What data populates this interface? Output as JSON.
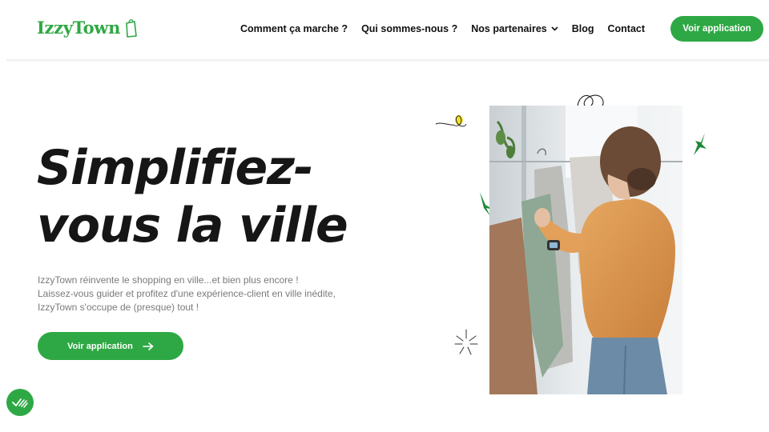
{
  "header": {
    "logo_text": "IzzyTown",
    "nav": [
      {
        "label": "Comment ça marche ?",
        "has_dropdown": false
      },
      {
        "label": "Qui sommes-nous ?",
        "has_dropdown": false
      },
      {
        "label": "Nos partenaires",
        "has_dropdown": true
      },
      {
        "label": "Blog",
        "has_dropdown": false
      },
      {
        "label": "Contact",
        "has_dropdown": false
      }
    ],
    "cta_label": "Voir application"
  },
  "hero": {
    "title_line1": "Simplifiez-",
    "title_line2": "vous la ville",
    "description": [
      "IzzyTown réinvente le shopping en ville...et bien plus encore !",
      "Laissez-vous guider et profitez d'une expérience-client en ville inédite,",
      "IzzyTown s'occupe de (presque) tout !"
    ],
    "cta_label": "Voir application",
    "cta_icon": "arrow-right-icon"
  },
  "colors": {
    "brand_green": "#2ea844",
    "title": "#161616",
    "body_text": "#7a7a7a"
  },
  "badge_icon": "accessibility-check-icon"
}
